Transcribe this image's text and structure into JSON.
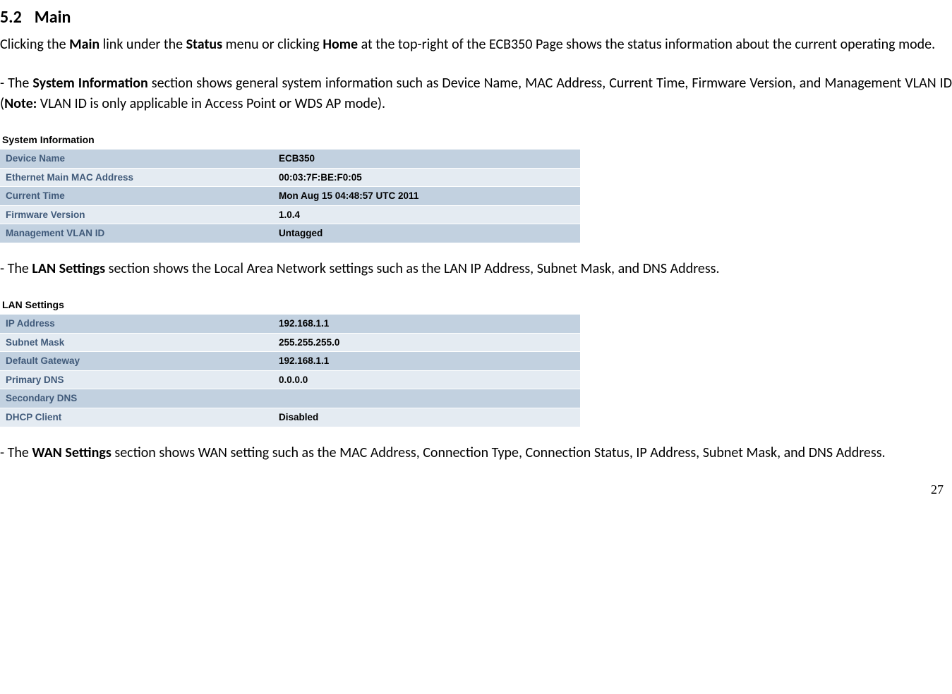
{
  "heading_num": "5.2",
  "heading_title": "Main",
  "para1": {
    "t1": "Clicking the ",
    "t2": "Main",
    "t3": " link under the ",
    "t4": "Status",
    "t5": " menu or clicking ",
    "t6": "Home",
    "t7": " at the top-right of the ECB350 Page shows the status information about the current operating mode."
  },
  "para2": {
    "t1": "- The ",
    "t2": "System Information",
    "t3": " section shows general system information such as Device Name, MAC Address, Current Time, Firmware Version, and Management VLAN ID (",
    "t4": "Note:",
    "t5": " VLAN ID is only applicable in Access Point or WDS AP mode)."
  },
  "table1": {
    "caption": "System Information",
    "rows": [
      {
        "label": "Device Name",
        "value": "ECB350"
      },
      {
        "label": "Ethernet Main MAC Address",
        "value": "00:03:7F:BE:F0:05"
      },
      {
        "label": "Current Time",
        "value": "Mon Aug 15 04:48:57 UTC 2011"
      },
      {
        "label": "Firmware Version",
        "value": "1.0.4"
      },
      {
        "label": "Management VLAN ID",
        "value": "Untagged"
      }
    ]
  },
  "para3": {
    "t1": "- The ",
    "t2": "LAN Settings",
    "t3": " section shows the Local Area Network settings such as the LAN IP Address, Subnet Mask, and DNS Address."
  },
  "table2": {
    "caption": "LAN Settings",
    "rows": [
      {
        "label": "IP Address",
        "value": "192.168.1.1"
      },
      {
        "label": "Subnet Mask",
        "value": "255.255.255.0"
      },
      {
        "label": "Default Gateway",
        "value": "192.168.1.1"
      },
      {
        "label": "Primary DNS",
        "value": "0.0.0.0"
      },
      {
        "label": "Secondary DNS",
        "value": ""
      },
      {
        "label": "DHCP Client",
        "value": "Disabled"
      }
    ]
  },
  "para4": {
    "t1": "- The ",
    "t2": "WAN Settings",
    "t3": " section shows WAN setting such as the MAC Address, Connection Type, Connection Status, IP Address, Subnet Mask, and DNS Address."
  },
  "page_number": "27"
}
